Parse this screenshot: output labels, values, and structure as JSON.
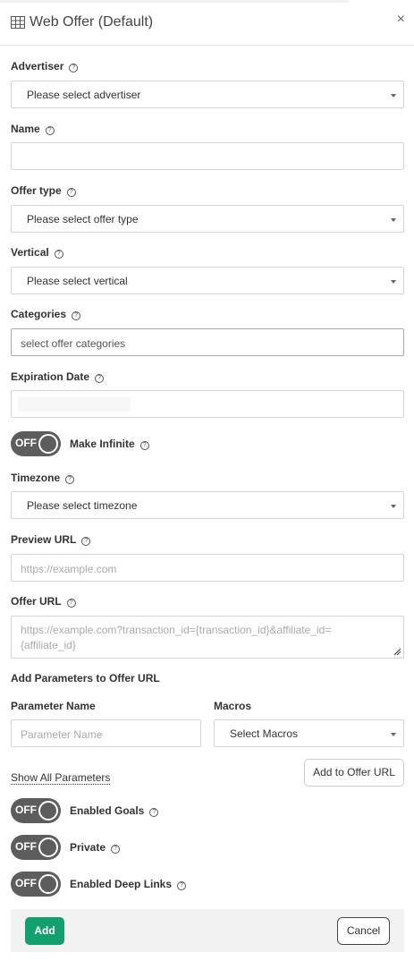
{
  "header": {
    "title": "Web Offer (Default)",
    "close": "×"
  },
  "help_glyph": "?",
  "fields": {
    "advertiser": {
      "label": "Advertiser",
      "value": "Please select advertiser"
    },
    "name": {
      "label": "Name",
      "value": ""
    },
    "offer_type": {
      "label": "Offer type",
      "value": "Please select offer type"
    },
    "vertical": {
      "label": "Vertical",
      "value": "Please select vertical"
    },
    "categories": {
      "label": "Categories",
      "placeholder": "select offer categories"
    },
    "expiration_date": {
      "label": "Expiration Date",
      "value": ""
    },
    "make_infinite": {
      "label": "Make Infinite",
      "state": "OFF"
    },
    "timezone": {
      "label": "Timezone",
      "value": "Please select timezone"
    },
    "preview_url": {
      "label": "Preview URL",
      "placeholder": "https://example.com"
    },
    "offer_url": {
      "label": "Offer URL",
      "placeholder_line1": "https://example.com?transaction_id={transaction_id}&affiliate_id=",
      "placeholder_line2": "{affiliate_id}"
    }
  },
  "params": {
    "section_label": "Add Parameters to Offer URL",
    "parameter_name_label": "Parameter Name",
    "parameter_name_placeholder": "Parameter Name",
    "macros_label": "Macros",
    "macros_value": "Select Macros",
    "show_all": "Show All Parameters",
    "add_to_url": "Add to Offer URL"
  },
  "toggles": {
    "enabled_goals": {
      "label": "Enabled Goals",
      "state": "OFF"
    },
    "private": {
      "label": "Private",
      "state": "OFF"
    },
    "enabled_deep_links": {
      "label": "Enabled Deep Links",
      "state": "OFF"
    }
  },
  "footer": {
    "add": "Add",
    "cancel": "Cancel"
  },
  "colors": {
    "primary": "#149f6f",
    "toggle_off": "#5d5d5d"
  },
  "icons": {
    "title": "table-grid-icon",
    "help": "question-circle-icon",
    "dropdown": "caret-down-icon"
  }
}
